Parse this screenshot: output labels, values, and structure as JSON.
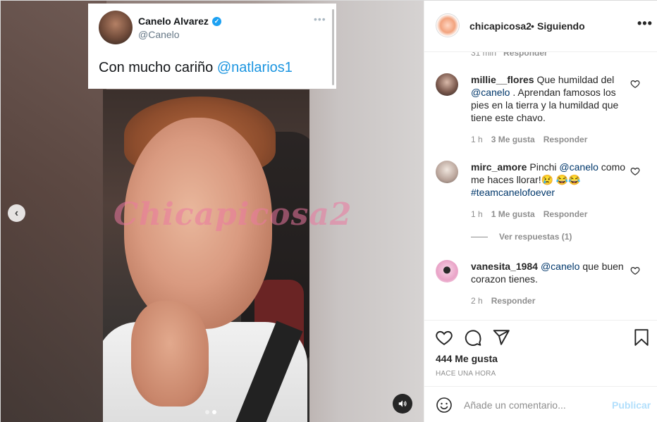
{
  "tweet": {
    "name": "Canelo Alvarez",
    "handle": "@Canelo",
    "text_prefix": "Con mucho cariño ",
    "text_mention": "@natlarios1"
  },
  "watermark": "Chicapicosa2",
  "post": {
    "username": "chicapicosa2",
    "separator": "•",
    "follow_status": "Siguiendo",
    "likes": "444 Me gusta",
    "time": "HACE UNA HORA"
  },
  "cut_comment": {
    "time": "31 min",
    "reply": "Responder"
  },
  "comments": [
    {
      "user": "millie__flores",
      "text_before": "Que humildad del ",
      "mention": "@canelo",
      "text_after": " . Aprendan famosos los pies en la tierra y la humildad que tiene este chavo.",
      "time": "1 h",
      "likes": "3 Me gusta",
      "reply": "Responder"
    },
    {
      "user": "mirc_amore",
      "text_before": "Pinchi ",
      "mention": "@canelo",
      "text_after": " como me haces llorar!😢 😂😂 ",
      "hashtag": "#teamcanelofoever",
      "time": "1 h",
      "likes": "1 Me gusta",
      "reply": "Responder"
    },
    {
      "user": "vanesita_1984",
      "text_before": "",
      "mention": "@canelo",
      "text_after": " que buen corazon tienes.",
      "time": "2 h",
      "reply": "Responder"
    }
  ],
  "view_replies": "Ver respuestas (1)",
  "add_comment": {
    "placeholder": "Añade un comentario...",
    "publish": "Publicar"
  }
}
